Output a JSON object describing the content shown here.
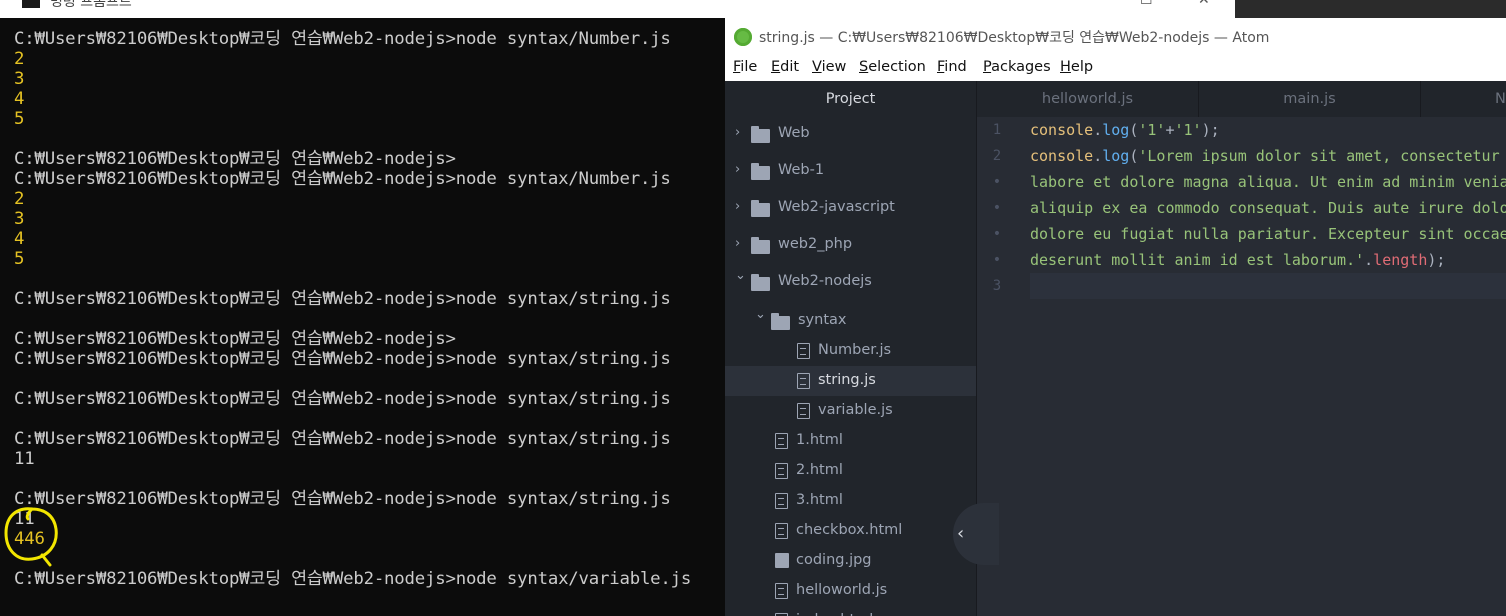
{
  "cmd": {
    "title": "명령 프롬프트",
    "lines": [
      {
        "text": "C:₩Users₩82106₩Desktop₩코딩 연습₩Web2-nodejs>node syntax/Number.js",
        "kind": "prompt"
      },
      {
        "text": "2",
        "kind": "output"
      },
      {
        "text": "3",
        "kind": "output"
      },
      {
        "text": "4",
        "kind": "output"
      },
      {
        "text": "5",
        "kind": "output"
      },
      {
        "text": "",
        "kind": "blank"
      },
      {
        "text": "C:₩Users₩82106₩Desktop₩코딩 연습₩Web2-nodejs>",
        "kind": "prompt"
      },
      {
        "text": "C:₩Users₩82106₩Desktop₩코딩 연습₩Web2-nodejs>node syntax/Number.js",
        "kind": "prompt"
      },
      {
        "text": "2",
        "kind": "output"
      },
      {
        "text": "3",
        "kind": "output"
      },
      {
        "text": "4",
        "kind": "output"
      },
      {
        "text": "5",
        "kind": "output"
      },
      {
        "text": "",
        "kind": "blank"
      },
      {
        "text": "C:₩Users₩82106₩Desktop₩코딩 연습₩Web2-nodejs>node syntax/string.js",
        "kind": "prompt"
      },
      {
        "text": "",
        "kind": "blank"
      },
      {
        "text": "C:₩Users₩82106₩Desktop₩코딩 연습₩Web2-nodejs>",
        "kind": "prompt"
      },
      {
        "text": "C:₩Users₩82106₩Desktop₩코딩 연습₩Web2-nodejs>node syntax/string.js",
        "kind": "prompt"
      },
      {
        "text": "",
        "kind": "blank"
      },
      {
        "text": "C:₩Users₩82106₩Desktop₩코딩 연습₩Web2-nodejs>node syntax/string.js",
        "kind": "prompt"
      },
      {
        "text": "",
        "kind": "blank"
      },
      {
        "text": "C:₩Users₩82106₩Desktop₩코딩 연습₩Web2-nodejs>node syntax/string.js",
        "kind": "prompt"
      },
      {
        "text": "11",
        "kind": "prompt"
      },
      {
        "text": "",
        "kind": "blank"
      },
      {
        "text": "C:₩Users₩82106₩Desktop₩코딩 연습₩Web2-nodejs>node syntax/string.js",
        "kind": "prompt"
      },
      {
        "text": "11",
        "kind": "prompt"
      },
      {
        "text": "446",
        "kind": "output"
      },
      {
        "text": "",
        "kind": "blank"
      },
      {
        "text": "C:₩Users₩82106₩Desktop₩코딩 연습₩Web2-nodejs>node syntax/variable.js",
        "kind": "prompt"
      }
    ],
    "colors": {
      "background": "#0c0c0c",
      "text": "#cccccc",
      "output": "#e5c223",
      "highlight": "#f2e600"
    }
  },
  "atom": {
    "title": "string.js — C:₩Users₩82106₩Desktop₩코딩 연습₩Web2-nodejs — Atom",
    "menu": [
      {
        "label": "File",
        "acc": "F",
        "rest": "ile"
      },
      {
        "label": "Edit",
        "acc": "E",
        "rest": "dit"
      },
      {
        "label": "View",
        "acc": "V",
        "rest": "iew"
      },
      {
        "label": "Selection",
        "acc": "S",
        "rest": "election"
      },
      {
        "label": "Find",
        "acc": "F",
        "rest": "ind"
      },
      {
        "label": "Packages",
        "acc": "P",
        "rest": "ackages"
      },
      {
        "label": "Help",
        "acc": "H",
        "rest": "elp"
      }
    ],
    "tree": {
      "header": "Project",
      "items": [
        {
          "label": "Web",
          "type": "folder",
          "state": "collapsed",
          "depth": 0
        },
        {
          "label": "Web-1",
          "type": "folder",
          "state": "collapsed",
          "depth": 0
        },
        {
          "label": "Web2-javascript",
          "type": "folder",
          "state": "collapsed",
          "depth": 0
        },
        {
          "label": "web2_php",
          "type": "folder",
          "state": "collapsed",
          "depth": 0
        },
        {
          "label": "Web2-nodejs",
          "type": "folder",
          "state": "expanded",
          "depth": 0
        },
        {
          "label": "syntax",
          "type": "folder",
          "state": "expanded",
          "depth": 1
        },
        {
          "label": "Number.js",
          "type": "file",
          "depth": 2
        },
        {
          "label": "string.js",
          "type": "file",
          "depth": 2,
          "selected": true
        },
        {
          "label": "variable.js",
          "type": "file",
          "depth": 2
        },
        {
          "label": "1.html",
          "type": "file",
          "depth": 1
        },
        {
          "label": "2.html",
          "type": "file",
          "depth": 1
        },
        {
          "label": "3.html",
          "type": "file",
          "depth": 1
        },
        {
          "label": "checkbox.html",
          "type": "file",
          "depth": 1
        },
        {
          "label": "coding.jpg",
          "type": "image",
          "depth": 1
        },
        {
          "label": "helloworld.js",
          "type": "file",
          "depth": 1
        },
        {
          "label": "index.html",
          "type": "file",
          "depth": 1
        }
      ]
    },
    "tabs": [
      {
        "label": "helloworld.js"
      },
      {
        "label": "main.js"
      },
      {
        "label": "N"
      }
    ],
    "editor": {
      "gutter": [
        "1",
        "2",
        "•",
        "•",
        "•",
        "•",
        "3"
      ],
      "lines": [
        [
          [
            "k-obj",
            "console"
          ],
          [
            "",
            "."
          ],
          [
            "k-fn",
            "log"
          ],
          [
            "",
            "("
          ],
          [
            "k-str",
            "'1'"
          ],
          [
            "",
            "+"
          ],
          [
            "k-str",
            "'1'"
          ],
          [
            "",
            ");"
          ]
        ],
        [
          [
            "k-obj",
            "console"
          ],
          [
            "",
            "."
          ],
          [
            "k-fn",
            "log"
          ],
          [
            "",
            "("
          ],
          [
            "k-str",
            "'Lorem ipsum dolor sit amet, consectetur adipiscing"
          ]
        ],
        [
          [
            "k-str",
            "labore et dolore magna aliqua. Ut enim ad minim veniam,"
          ]
        ],
        [
          [
            "k-str",
            "aliquip ex ea commodo consequat. Duis aute irure dolor"
          ]
        ],
        [
          [
            "k-str",
            "dolore eu fugiat nulla pariatur. Excepteur sint occaecat"
          ]
        ],
        [
          [
            "k-str",
            "deserunt mollit anim id est laborum.'"
          ],
          [
            "",
            "."
          ],
          [
            "k-prop",
            "length"
          ],
          [
            "",
            ");"
          ]
        ],
        []
      ]
    }
  }
}
